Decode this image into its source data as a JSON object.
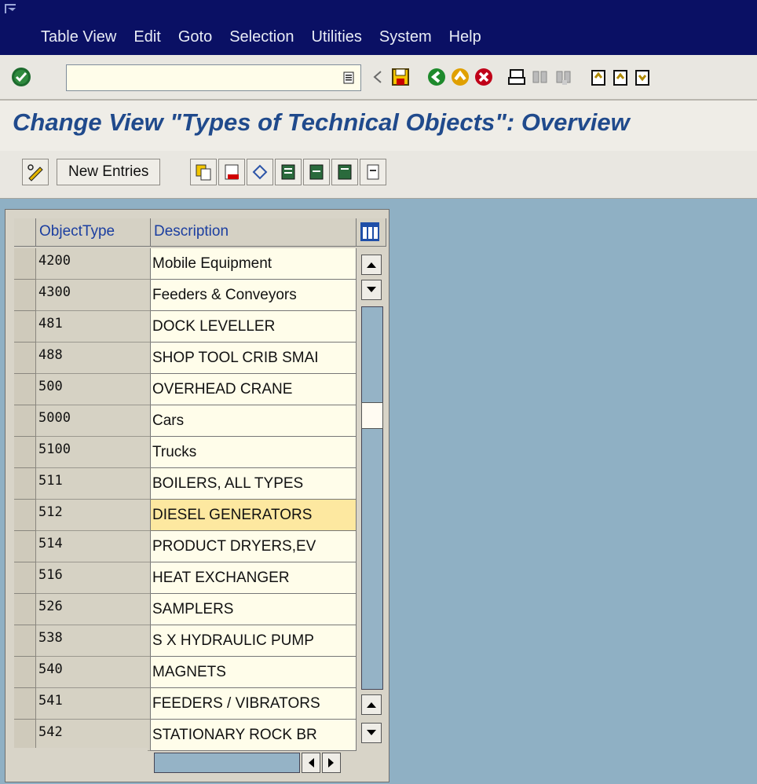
{
  "menubar": {
    "items": [
      {
        "label": "Table View"
      },
      {
        "label": "Edit"
      },
      {
        "label": "Goto"
      },
      {
        "label": "Selection"
      },
      {
        "label": "Utilities"
      },
      {
        "label": "System"
      },
      {
        "label": "Help"
      }
    ]
  },
  "toolbar": {
    "command_value": "",
    "icons": [
      "enter-icon",
      "back-arrow-icon",
      "save-icon",
      "back-icon",
      "exit-icon",
      "cancel-icon",
      "print-icon",
      "find-icon",
      "find-next-icon",
      "first-page-icon",
      "previous-page-icon",
      "next-page-icon"
    ]
  },
  "page": {
    "title": "Change View \"Types of Technical Objects\": Overview"
  },
  "app_toolbar": {
    "new_entries_label": "New Entries"
  },
  "table": {
    "headers": {
      "object_type": "ObjectType",
      "description": "Description"
    },
    "rows": [
      {
        "object_type": "4200",
        "description": "Mobile Equipment"
      },
      {
        "object_type": "4300",
        "description": "Feeders & Conveyors"
      },
      {
        "object_type": "481",
        "description": "DOCK LEVELLER"
      },
      {
        "object_type": "488",
        "description": "SHOP TOOL CRIB SMAI"
      },
      {
        "object_type": "500",
        "description": "OVERHEAD CRANE"
      },
      {
        "object_type": "5000",
        "description": "Cars"
      },
      {
        "object_type": "5100",
        "description": "Trucks"
      },
      {
        "object_type": "511",
        "description": "BOILERS, ALL TYPES"
      },
      {
        "object_type": "512",
        "description": "DIESEL GENERATORS"
      },
      {
        "object_type": "514",
        "description": "PRODUCT DRYERS,EV"
      },
      {
        "object_type": "516",
        "description": "HEAT EXCHANGER"
      },
      {
        "object_type": "526",
        "description": "SAMPLERS"
      },
      {
        "object_type": "538",
        "description": "S X HYDRAULIC PUMP"
      },
      {
        "object_type": "540",
        "description": "MAGNETS"
      },
      {
        "object_type": "541",
        "description": "FEEDERS / VIBRATORS"
      },
      {
        "object_type": "542",
        "description": "STATIONARY ROCK BR"
      }
    ]
  }
}
